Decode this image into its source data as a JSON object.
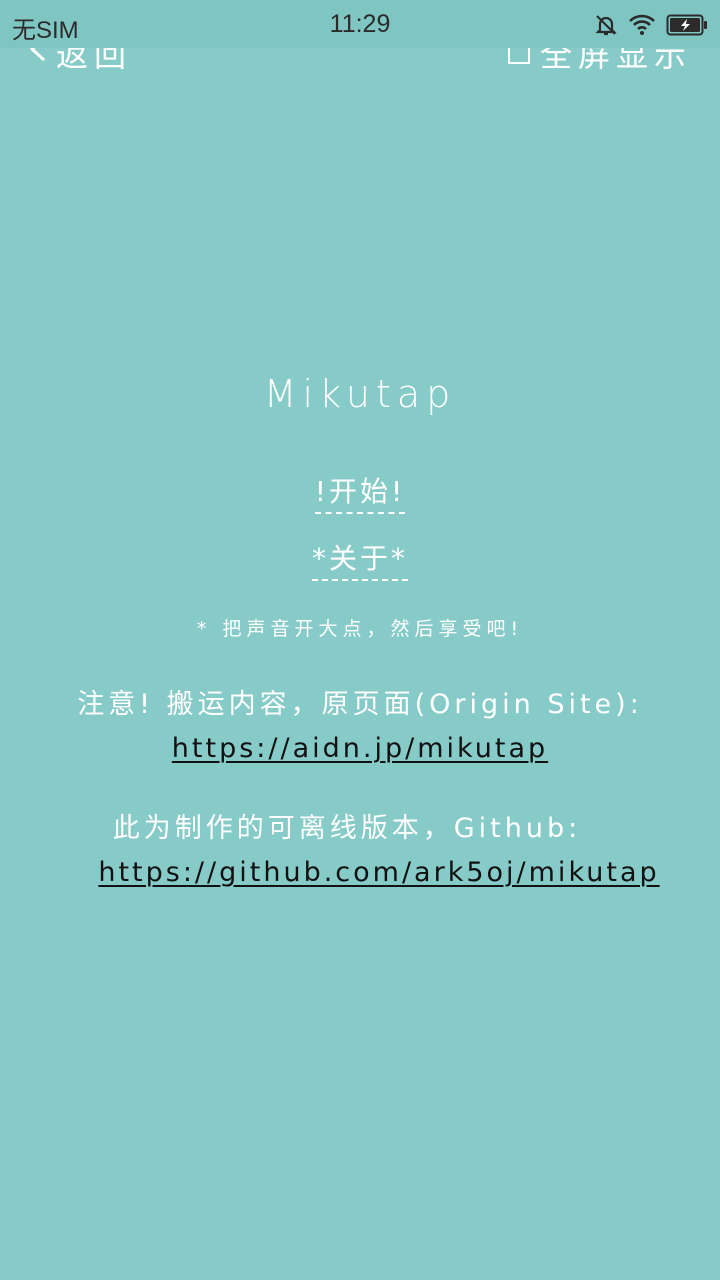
{
  "status_bar": {
    "carrier": "无SIM",
    "time": "11:29",
    "icons": [
      "mute-bell-icon",
      "wifi-icon",
      "battery-charging-icon"
    ]
  },
  "topbar": {
    "back_label": "返回",
    "fullscreen_label": "全屏显示"
  },
  "main": {
    "title": "Mikutap",
    "start_label": "!开始!",
    "about_label": "*关于*",
    "tip": "* 把声音开大点，然后享受吧!",
    "notice_text": "注意! 搬运内容，原页面(Origin Site):",
    "origin_link": "https://aidn.jp/mikutap",
    "github_text": "此为制作的可离线版本，Github:",
    "github_link": "https://github.com/ark5oj/mikutap"
  },
  "colors": {
    "background": "#87cbc9",
    "status_bar": "#7fc6c3",
    "text": "#ffffff",
    "link": "#111111"
  }
}
